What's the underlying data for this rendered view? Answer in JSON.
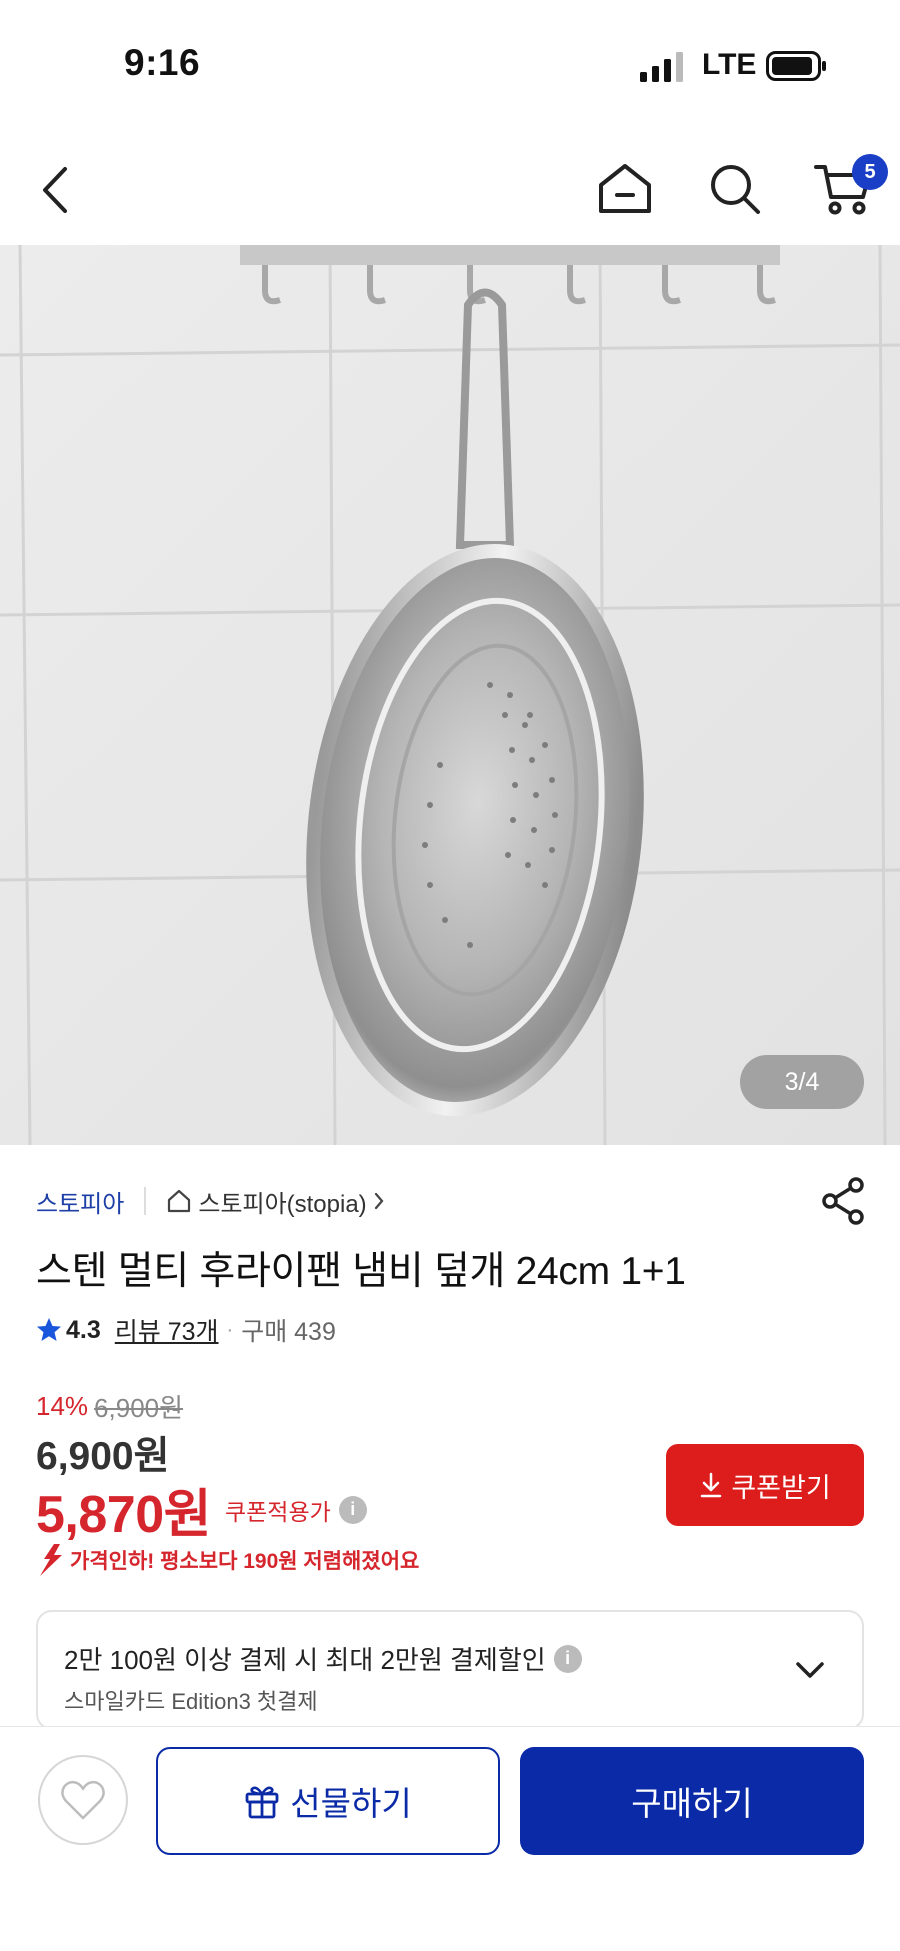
{
  "status_bar": {
    "time": "9:16",
    "network": "LTE"
  },
  "header": {
    "cart_count": "5"
  },
  "gallery": {
    "counter": "3/4"
  },
  "product": {
    "brand": "스토피아",
    "store": "스토피아(stopia)",
    "title": "스텐 멀티 후라이팬 냄비 덮개 24cm 1+1",
    "rating": "4.3",
    "reviews": "리뷰 73개",
    "purchases": "구매 439",
    "discount_rate": "14%",
    "original_price": "6,900원",
    "sale_price": "6,900원",
    "coupon_price": "5,870원",
    "coupon_price_label": "쿠폰적용가",
    "coupon_button": "쿠폰받기",
    "price_drop": "가격인하! 평소보다 190원 저렴해졌어요"
  },
  "card_promo": {
    "title": "2만 100원 이상 결제 시 최대 2만원 결제할인",
    "subtitle": "스마일카드 Edition3 첫결제"
  },
  "bottom_bar": {
    "gift_label": "선물하기",
    "buy_label": "구매하기"
  },
  "colors": {
    "accent_blue": "#0a2aa8",
    "sale_red": "#d6262d",
    "star_blue": "#1a56db"
  }
}
